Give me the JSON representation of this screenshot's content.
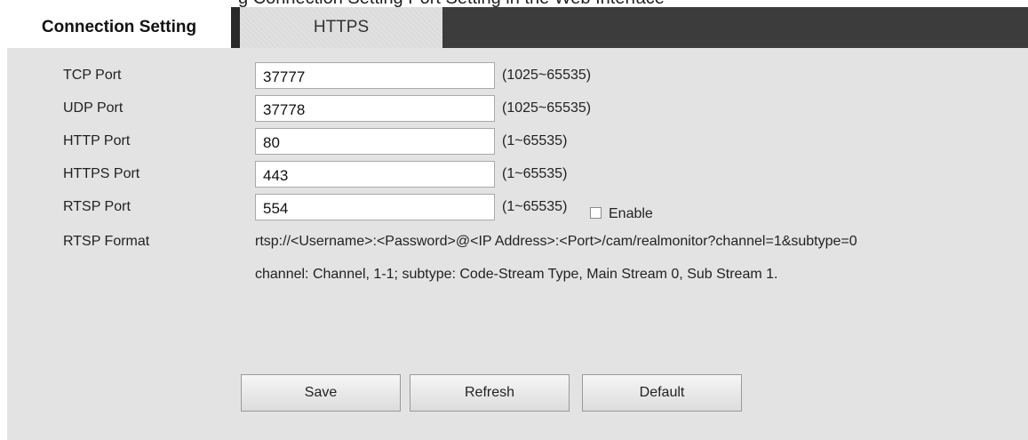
{
  "top_cut_text": "g Connection Setting       Port Setting in the Web Interface",
  "tabs": {
    "connection": "Connection Setting",
    "https": "HTTPS"
  },
  "ports": [
    {
      "label": "TCP Port",
      "value": "37777",
      "range": "(1025~65535)"
    },
    {
      "label": "UDP Port",
      "value": "37778",
      "range": "(1025~65535)"
    },
    {
      "label": "HTTP Port",
      "value": "80",
      "range": "(1~65535)"
    },
    {
      "label": "HTTPS Port",
      "value": "443",
      "range": "(1~65535)"
    },
    {
      "label": "RTSP Port",
      "value": "554",
      "range": "(1~65535)"
    }
  ],
  "https_enable": {
    "label": "Enable",
    "checked": false
  },
  "rtsp": {
    "label": "RTSP Format",
    "format": "rtsp://<Username>:<Password>@<IP Address>:<Port>/cam/realmonitor?channel=1&subtype=0",
    "note": "channel: Channel, 1-1; subtype: Code-Stream Type, Main Stream 0, Sub Stream 1."
  },
  "buttons": {
    "save": "Save",
    "refresh": "Refresh",
    "default": "Default"
  }
}
